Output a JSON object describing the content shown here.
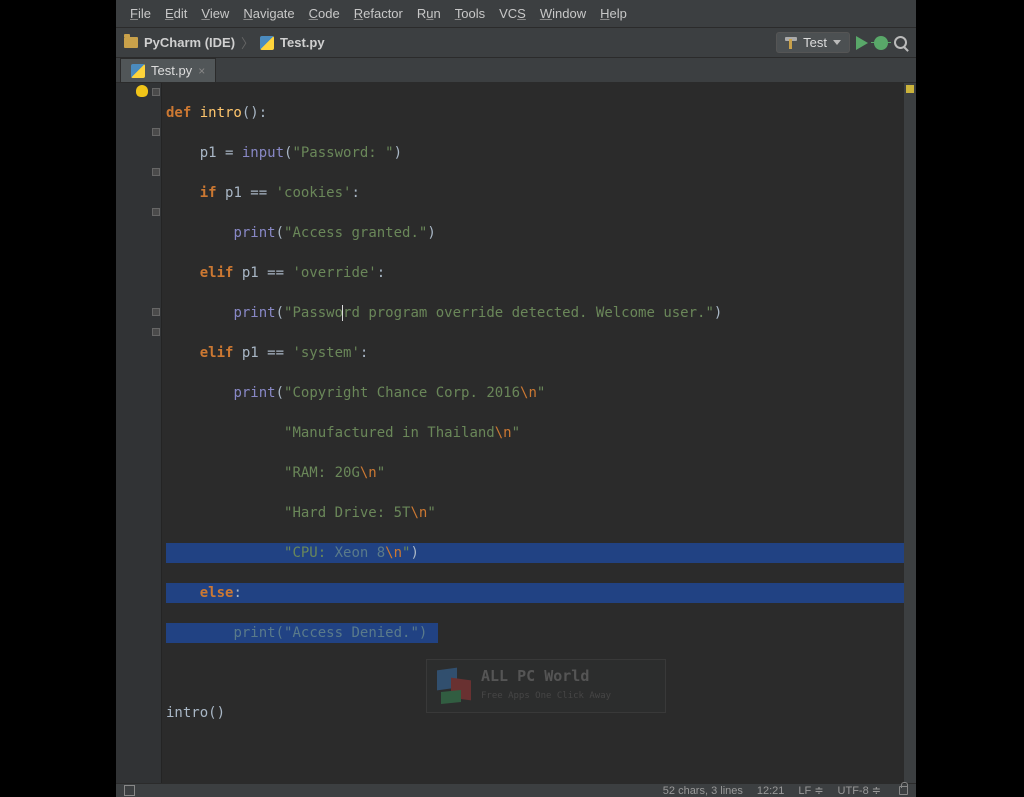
{
  "menu": {
    "items": [
      "File",
      "Edit",
      "View",
      "Navigate",
      "Code",
      "Refactor",
      "Run",
      "Tools",
      "VCS",
      "Window",
      "Help"
    ]
  },
  "breadcrumb": {
    "project": "PyCharm (IDE)",
    "file": "Test.py"
  },
  "run": {
    "config": "Test"
  },
  "tab": {
    "name": "Test.py"
  },
  "code": {
    "l1_def": "def ",
    "l1_fn": "intro",
    "l1_tail": "():",
    "l2_a": "    p1 = ",
    "l2_b": "input",
    "l2_c": "(",
    "l2_str": "\"Password: \"",
    "l2_d": ")",
    "l3_a": "    ",
    "l3_if": "if ",
    "l3_b": "p1 == ",
    "l3_str": "'cookies'",
    "l3_c": ":",
    "l4_a": "        ",
    "l4_p": "print",
    "l4_b": "(",
    "l4_str": "\"Access granted.\"",
    "l4_c": ")",
    "l5_a": "    ",
    "l5_elif": "elif ",
    "l5_b": "p1 == ",
    "l5_str": "'override'",
    "l5_c": ":",
    "l6_a": "        ",
    "l6_p": "print",
    "l6_b": "(",
    "l6_str": "\"Password program override detected. Welcome user.\"",
    "l6_c": ")",
    "l7_a": "    ",
    "l7_elif": "elif ",
    "l7_b": "p1 == ",
    "l7_str": "'system'",
    "l7_c": ":",
    "l8_a": "        ",
    "l8_p": "print",
    "l8_b": "(",
    "l8_str1": "\"Copyright Chance Corp. 2016",
    "l8_esc": "\\n",
    "l8_str2": "\"",
    "l9_pad": "              ",
    "l9_s1": "\"Manufactured in Thailand",
    "l9_esc": "\\n",
    "l9_s2": "\"",
    "l10_pad": "              ",
    "l10_s1": "\"RAM: 20G",
    "l10_esc": "\\n",
    "l10_s2": "\"",
    "l11_pad": "              ",
    "l11_s1": "\"Hard Drive: 5T",
    "l11_esc": "\\n",
    "l11_s2": "\"",
    "l12_pad": "              ",
    "l12_s1": "\"CPU: ",
    "l12_mid": "Xeon 8",
    "l12_esc": "\\n",
    "l12_s2": "\"",
    "l12_c": ")",
    "l13_a": "    ",
    "l13_else": "else",
    "l13_b": ":",
    "l14_a": "        ",
    "l14_p": "print",
    "l14_b": "(",
    "l14_str": "\"Access Denied.\"",
    "l14_c": ")",
    "l16": "intro()"
  },
  "status": {
    "sel": "52 chars, 3 lines",
    "pos": "12:21",
    "le": "LF",
    "enc": "UTF-8"
  },
  "watermark": {
    "title": "ALL PC World",
    "sub": "Free Apps One Click Away"
  }
}
